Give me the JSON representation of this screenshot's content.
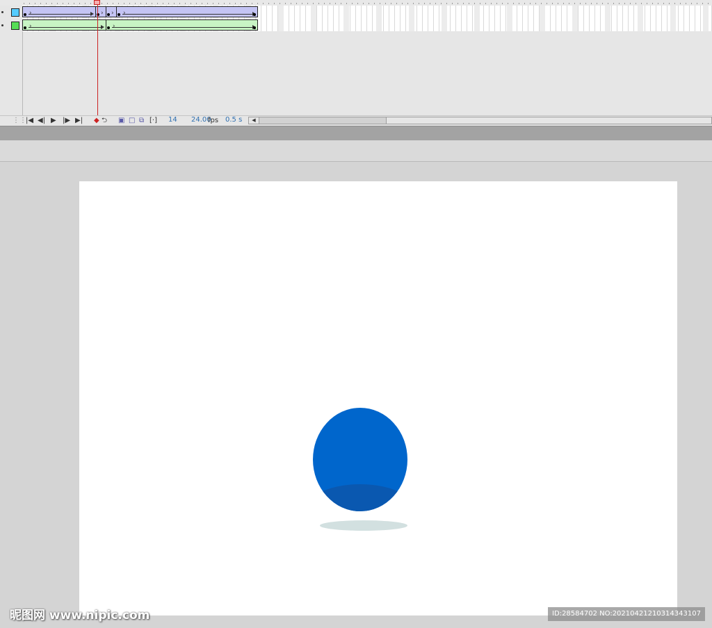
{
  "timeline": {
    "layers": [
      {
        "color": "#55ccff",
        "selected": true
      },
      {
        "color": "#55dd55",
        "selected": false
      }
    ],
    "tween_colors": {
      "layer1": "#c4c4f4",
      "layer2": "#c8f4c4"
    },
    "controls": {
      "current_frame": "14",
      "frame_rate": "24.00",
      "fps_unit": "fps",
      "elapsed_time": "0.5 s"
    }
  },
  "stage": {
    "background": "#ffffff",
    "ball_color": "#0066cc",
    "ball_shade_color": "#0a58b0",
    "shadow_color": "#d2e0e0"
  },
  "watermark": {
    "site": "昵图网 www.nipic.com",
    "id_text": "ID:28584702 NO:20210421210314343107"
  }
}
